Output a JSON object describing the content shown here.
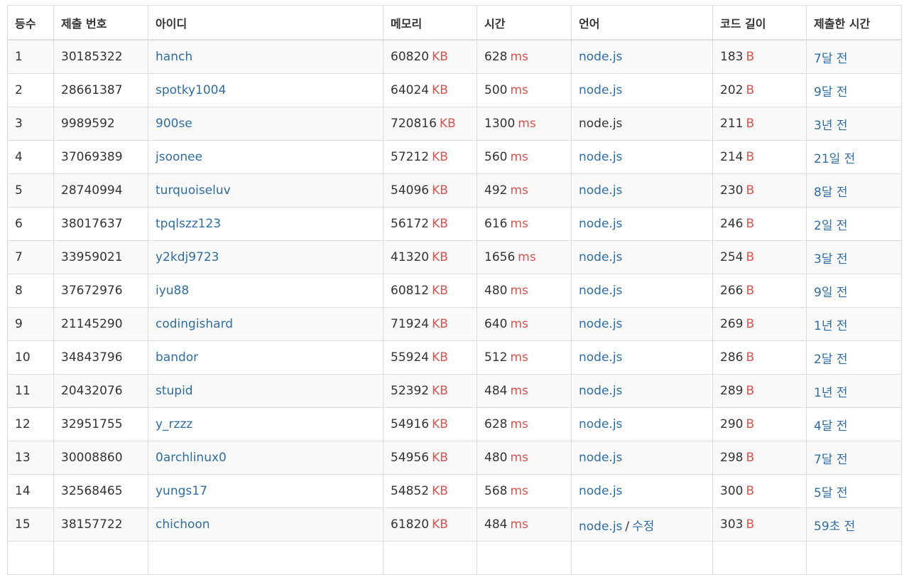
{
  "headers": [
    "등수",
    "제출 번호",
    "아이디",
    "메모리",
    "시간",
    "언어",
    "코드 길이",
    "제출한 시간"
  ],
  "units": {
    "memory": "KB",
    "time": "ms",
    "code": "B"
  },
  "edit_sep": "/",
  "edit_label": "수정",
  "rows": [
    {
      "rank": "1",
      "id": "30185322",
      "user": "hanch",
      "memory": "60820",
      "time": "628",
      "lang": "node.js",
      "lang_link": true,
      "code": "183",
      "ago": "7달 전"
    },
    {
      "rank": "2",
      "id": "28661387",
      "user": "spotky1004",
      "memory": "64024",
      "time": "500",
      "lang": "node.js",
      "lang_link": true,
      "code": "202",
      "ago": "9달 전"
    },
    {
      "rank": "3",
      "id": "9989592",
      "user": "900se",
      "memory": "720816",
      "time": "1300",
      "lang": "node.js",
      "lang_link": false,
      "code": "211",
      "ago": "3년 전"
    },
    {
      "rank": "4",
      "id": "37069389",
      "user": "jsoonee",
      "memory": "57212",
      "time": "560",
      "lang": "node.js",
      "lang_link": true,
      "code": "214",
      "ago": "21일 전"
    },
    {
      "rank": "5",
      "id": "28740994",
      "user": "turquoiseluv",
      "memory": "54096",
      "time": "492",
      "lang": "node.js",
      "lang_link": true,
      "code": "230",
      "ago": "8달 전"
    },
    {
      "rank": "6",
      "id": "38017637",
      "user": "tpqlszz123",
      "memory": "56172",
      "time": "616",
      "lang": "node.js",
      "lang_link": true,
      "code": "246",
      "ago": "2일 전"
    },
    {
      "rank": "7",
      "id": "33959021",
      "user": "y2kdj9723",
      "memory": "41320",
      "time": "1656",
      "lang": "node.js",
      "lang_link": true,
      "code": "254",
      "ago": "3달 전"
    },
    {
      "rank": "8",
      "id": "37672976",
      "user": "iyu88",
      "memory": "60812",
      "time": "480",
      "lang": "node.js",
      "lang_link": true,
      "code": "266",
      "ago": "9일 전"
    },
    {
      "rank": "9",
      "id": "21145290",
      "user": "codingishard",
      "memory": "71924",
      "time": "640",
      "lang": "node.js",
      "lang_link": true,
      "code": "269",
      "ago": "1년 전"
    },
    {
      "rank": "10",
      "id": "34843796",
      "user": "bandor",
      "memory": "55924",
      "time": "512",
      "lang": "node.js",
      "lang_link": true,
      "code": "286",
      "ago": "2달 전"
    },
    {
      "rank": "11",
      "id": "20432076",
      "user": "stupid",
      "memory": "52392",
      "time": "484",
      "lang": "node.js",
      "lang_link": true,
      "code": "289",
      "ago": "1년 전"
    },
    {
      "rank": "12",
      "id": "32951755",
      "user": "y_rzzz",
      "memory": "54916",
      "time": "628",
      "lang": "node.js",
      "lang_link": true,
      "code": "290",
      "ago": "4달 전"
    },
    {
      "rank": "13",
      "id": "30008860",
      "user": "0archlinux0",
      "memory": "54956",
      "time": "480",
      "lang": "node.js",
      "lang_link": true,
      "code": "298",
      "ago": "7달 전"
    },
    {
      "rank": "14",
      "id": "32568465",
      "user": "yungs17",
      "memory": "54852",
      "time": "568",
      "lang": "node.js",
      "lang_link": true,
      "code": "300",
      "ago": "5달 전"
    },
    {
      "rank": "15",
      "id": "38157722",
      "user": "chichoon",
      "memory": "61820",
      "time": "484",
      "lang": "node.js",
      "lang_link": true,
      "edit": true,
      "code": "303",
      "ago": "59초 전"
    }
  ],
  "colors": {
    "link": "#2e6da4",
    "unit": "#d9534f",
    "border": "#dddddd",
    "stripe": "#f9f9f9"
  }
}
